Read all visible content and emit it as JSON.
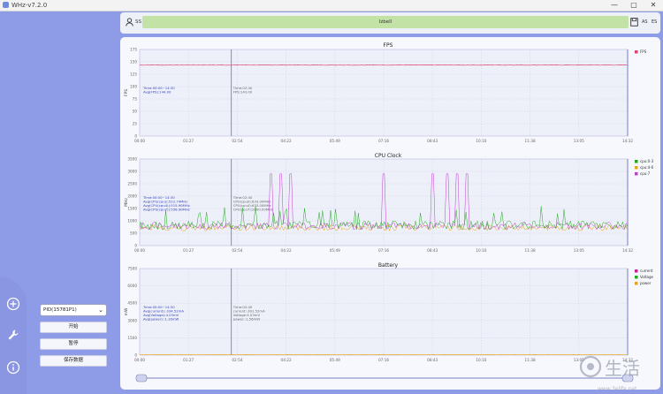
{
  "window": {
    "title": "WHz-v7.2.0",
    "controls": {
      "minimize": "—",
      "maximize": "▢",
      "close": "✕"
    }
  },
  "header": {
    "user_label": "SS",
    "device": "Izbell",
    "right_a": "AS",
    "right_b": "ES"
  },
  "sidebar": {
    "nav_icons": [
      "plus-circle-icon",
      "wrench-icon",
      "info-icon"
    ],
    "process_select": "PID(15781P1)",
    "buttons": {
      "start": "开始",
      "pause": "暂停",
      "save": "保存数据"
    }
  },
  "time_ticks": [
    "00:00",
    "01:27",
    "02:54",
    "04:22",
    "05:49",
    "07:16",
    "08:43",
    "10:10",
    "11:38",
    "13:05",
    "14:32"
  ],
  "cursor_fraction": 0.188,
  "slider": {
    "start": 0.0,
    "end": 1.0
  },
  "colors": {
    "accent": "#8e9be6",
    "fps": "#e0406a",
    "cpu0": "#22aa22",
    "cpu4": "#e8a319",
    "cpu7": "#c03bd0",
    "current": "#cc1fa0",
    "voltage": "#22aa22",
    "power": "#e8a319",
    "cursor": "#3344bb"
  },
  "charts": {
    "fps": {
      "title": "FPS",
      "ylabel": "FPS",
      "yticks": [
        "0",
        "25",
        "50",
        "75",
        "100",
        "125",
        "150",
        "175"
      ],
      "legend": [
        {
          "name": "FPS",
          "color": "#e0406a"
        }
      ],
      "info_left": [
        "Time:00:00~14:30",
        "Avg(FPS):144.00"
      ],
      "info_cursor": [
        "Time:02:40",
        "FPS:143.00"
      ]
    },
    "cpu": {
      "title": "CPU Clock",
      "ylabel": "MHz",
      "yticks": [
        "0",
        "500",
        "1000",
        "1500",
        "2000",
        "2500",
        "3000",
        "3500"
      ],
      "legend": [
        {
          "name": "cpu:0-3",
          "color": "#22aa22"
        },
        {
          "name": "cpu:4-6",
          "color": "#e8a319"
        },
        {
          "name": "cpu:7",
          "color": "#c03bd0"
        }
      ],
      "info_left": [
        "Time:00:00~14:30",
        "Avg(CPU(cpu)):512.74MHz",
        "Avg(CPU(cpu4)):515.90MHz",
        "Avg(CPU(cpu7)):556.90MHz"
      ],
      "info_cursor": [
        "Time:02:40",
        "CPU(cpu0):633.00MHz",
        "CPU(cpu4):633.00MHz",
        "CPU(cpu7):2000.00MHz"
      ]
    },
    "battery": {
      "title": "Battery",
      "ylabel": "mW",
      "yticks": [
        "0",
        "1500",
        "3000",
        "4500",
        "6000",
        "7500"
      ],
      "legend": [
        {
          "name": "current",
          "color": "#cc1fa0"
        },
        {
          "name": "Voltage",
          "color": "#22aa22"
        },
        {
          "name": "power",
          "color": "#e8a319"
        }
      ],
      "info_left": [
        "Time:00:00~14:30",
        "Avg(current):-334.52mA",
        "Avg(Voltage):4.03mV",
        "Avg(power):-1.16mW"
      ],
      "info_cursor": [
        "Time:02:40",
        "current:-391.52mA",
        "Voltage:4.03mV",
        "power:-1.56mW"
      ]
    }
  },
  "watermark": {
    "text": "生活",
    "sub": "www.3elife.net"
  }
}
